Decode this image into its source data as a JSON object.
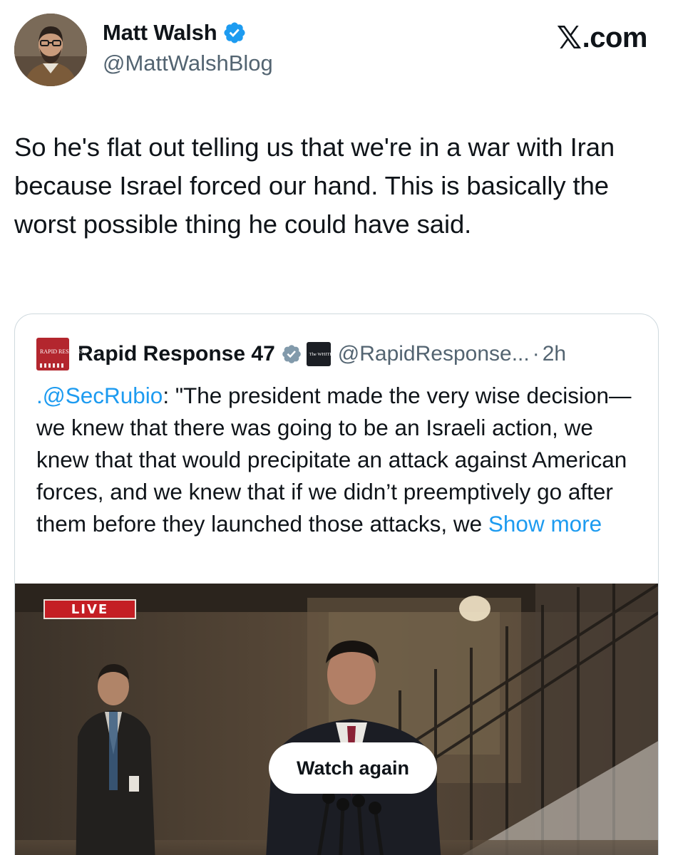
{
  "author": {
    "name": "Matt Walsh",
    "handle": "@MattWalshBlog",
    "verified": true,
    "verified_color": "#1d9bf0"
  },
  "site_brand": {
    "mark": "𝕏",
    "text": ".com"
  },
  "tweet": {
    "text": "So he's flat out telling us that we're in a war with Iran because Israel forced our hand. This is basically the worst possible thing he could have said."
  },
  "quoted_tweet": {
    "logo_text": "RAPID RESPONSE",
    "name": "Rapid Response 47",
    "verified": true,
    "verified_color": "#829aab",
    "affiliation_badge_text": "The WHITE HOUSE",
    "handle": "@RapidResponse...",
    "separator": "·",
    "time": "2h",
    "mention": ".@SecRubio",
    "body": ": \"The president made the very wise decision—we knew that there was going to be an Israeli action, we knew that that would precipitate an attack against American forces, and we knew that if we didn’t preemptively go after them before they launched those attacks, we ",
    "show_more": "Show more",
    "video": {
      "live_label": "LIVE",
      "watch_again_label": "Watch again"
    }
  }
}
